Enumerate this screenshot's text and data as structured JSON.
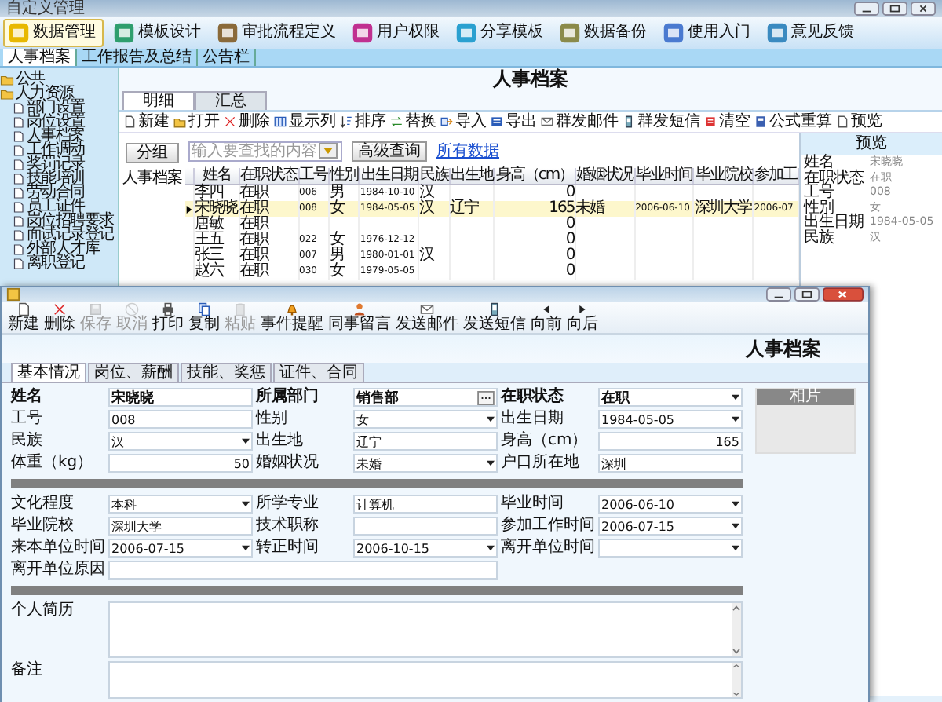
{
  "window": {
    "title": "自定义管理"
  },
  "main_toolbar": [
    {
      "label": "数据管理",
      "selected": true
    },
    {
      "label": "模板设计",
      "selected": false
    },
    {
      "label": "审批流程定义",
      "selected": false
    },
    {
      "label": "用户权限",
      "selected": false
    },
    {
      "label": "分享模板",
      "selected": false
    },
    {
      "label": "数据备份",
      "selected": false
    },
    {
      "label": "使用入门",
      "selected": false
    },
    {
      "label": "意见反馈",
      "selected": false
    }
  ],
  "doc_tabs": [
    {
      "label": "人事档案",
      "selected": true
    },
    {
      "label": "工作报告及总结",
      "selected": false
    },
    {
      "label": "公告栏",
      "selected": false
    }
  ],
  "tree": [
    {
      "label": "公共"
    },
    {
      "label": "人力资源",
      "children": [
        {
          "label": "部门设置"
        },
        {
          "label": "岗位设置"
        },
        {
          "label": "人事档案"
        },
        {
          "label": "工作调动"
        },
        {
          "label": "奖罚记录"
        },
        {
          "label": "技能培训"
        },
        {
          "label": "劳动合同"
        },
        {
          "label": "员工证件"
        },
        {
          "label": "岗位招聘要求"
        },
        {
          "label": "面试记录登记"
        },
        {
          "label": "外部人才库"
        },
        {
          "label": "离职登记"
        }
      ]
    }
  ],
  "page_title": "人事档案",
  "view_tabs": [
    {
      "label": "明细",
      "selected": true
    },
    {
      "label": "汇总",
      "selected": false
    }
  ],
  "list_toolbar": [
    "新建",
    "打开",
    "删除",
    "显示列",
    "排序",
    "替换",
    "导入",
    "导出",
    "群发邮件",
    "群发短信",
    "清空",
    "公式重算",
    "预览"
  ],
  "group_button": "分组",
  "group_tree": [
    "人事档案"
  ],
  "search": {
    "placeholder": "输入要查找的内容"
  },
  "advanced_button": "高级查询",
  "all_data_link": "所有数据",
  "table": {
    "columns": [
      "姓名",
      "在职状态",
      "工号",
      "性别",
      "出生日期",
      "民族",
      "出生地",
      "身高（cm）",
      "婚姻状况",
      "毕业时间",
      "毕业院校",
      "参加工"
    ],
    "rows": [
      {
        "selected": false,
        "cells": [
          "李四",
          "在职",
          "006",
          "男",
          "1984-10-10",
          "汉",
          "",
          "0",
          "",
          "",
          "",
          ""
        ]
      },
      {
        "selected": true,
        "cells": [
          "宋晓晓",
          "在职",
          "008",
          "女",
          "1984-05-05",
          "汉",
          "辽宁",
          "165",
          "未婚",
          "2006-06-10",
          "深圳大学",
          "2006-07"
        ]
      },
      {
        "selected": false,
        "cells": [
          "唐敏",
          "在职",
          "",
          "",
          "",
          "",
          "",
          "0",
          "",
          "",
          "",
          ""
        ]
      },
      {
        "selected": false,
        "cells": [
          "王五",
          "在职",
          "022",
          "女",
          "1976-12-12",
          "",
          "",
          "0",
          "",
          "",
          "",
          ""
        ]
      },
      {
        "selected": false,
        "cells": [
          "张三",
          "在职",
          "007",
          "男",
          "1980-01-01",
          "汉",
          "",
          "0",
          "",
          "",
          "",
          ""
        ]
      },
      {
        "selected": false,
        "cells": [
          "赵六",
          "在职",
          "030",
          "女",
          "1979-05-05",
          "",
          "",
          "0",
          "",
          "",
          "",
          ""
        ]
      }
    ]
  },
  "preview": {
    "title": "预览",
    "fields": [
      {
        "label": "姓名",
        "value": "宋晓晓"
      },
      {
        "label": "在职状态",
        "value": "在职"
      },
      {
        "label": "工号",
        "value": "008"
      },
      {
        "label": "性别",
        "value": "女"
      },
      {
        "label": "出生日期",
        "value": "1984-05-05"
      },
      {
        "label": "民族",
        "value": "汉"
      }
    ]
  },
  "dialog": {
    "toolbar": [
      {
        "label": "新建",
        "disabled": false
      },
      {
        "label": "删除",
        "disabled": false
      },
      {
        "label": "保存",
        "disabled": true
      },
      {
        "label": "取消",
        "disabled": true
      },
      {
        "label": "打印",
        "disabled": false
      },
      {
        "label": "复制",
        "disabled": false
      },
      {
        "label": "粘贴",
        "disabled": true
      },
      {
        "label": "事件提醒",
        "disabled": false
      },
      {
        "label": "同事留言",
        "disabled": false
      },
      {
        "label": "发送邮件",
        "disabled": false
      },
      {
        "label": "发送短信",
        "disabled": false
      },
      {
        "label": "向前",
        "disabled": false
      },
      {
        "label": "向后",
        "disabled": false
      }
    ],
    "title": "人事档案",
    "tabs": [
      {
        "label": "基本情况",
        "selected": true
      },
      {
        "label": "岗位、薪酬",
        "selected": false
      },
      {
        "label": "技能、奖惩",
        "selected": false
      },
      {
        "label": "证件、合同",
        "selected": false
      }
    ],
    "sections": [
      [
        {
          "label": "姓名",
          "value": "宋晓晓",
          "kind": "text",
          "bold": true
        },
        {
          "label": "所属部门",
          "value": "销售部",
          "kind": "lookup",
          "bold": true
        },
        {
          "label": "在职状态",
          "value": "在职",
          "kind": "select",
          "bold": true
        },
        {
          "label": "工号",
          "value": "008",
          "kind": "text",
          "bold": false
        },
        {
          "label": "性别",
          "value": "女",
          "kind": "select",
          "bold": false
        },
        {
          "label": "出生日期",
          "value": "1984-05-05",
          "kind": "select",
          "bold": false
        },
        {
          "label": "民族",
          "value": "汉",
          "kind": "select",
          "bold": false
        },
        {
          "label": "出生地",
          "value": "辽宁",
          "kind": "text",
          "bold": false
        },
        {
          "label": "身高（cm）",
          "value": "165",
          "kind": "number",
          "bold": false
        },
        {
          "label": "体重（kg）",
          "value": "50",
          "kind": "number",
          "bold": false
        },
        {
          "label": "婚姻状况",
          "value": "未婚",
          "kind": "select",
          "bold": false
        },
        {
          "label": "户口所在地",
          "value": "深圳",
          "kind": "text",
          "bold": false
        }
      ],
      [
        {
          "label": "文化程度",
          "value": "本科",
          "kind": "select",
          "bold": false
        },
        {
          "label": "所学专业",
          "value": "计算机",
          "kind": "text",
          "bold": false
        },
        {
          "label": "毕业时间",
          "value": "2006-06-10",
          "kind": "select",
          "bold": false
        },
        {
          "label": "毕业院校",
          "value": "深圳大学",
          "kind": "text",
          "bold": false
        },
        {
          "label": "技术职称",
          "kind": "text",
          "bold": false
        },
        {
          "label": "参加工作时间",
          "value": "2006-07-15",
          "kind": "select",
          "bold": false
        },
        {
          "label": "来本单位时间",
          "value": "2006-07-15",
          "kind": "select",
          "bold": false
        },
        {
          "label": "转正时间",
          "value": "2006-10-15",
          "kind": "select",
          "bold": false
        },
        {
          "label": "离开单位时间",
          "kind": "select",
          "bold": false
        },
        {
          "label": "离开单位原因",
          "kind": "wide",
          "bold": false
        }
      ]
    ],
    "memos": [
      {
        "label": "个人简历",
        "kind": "tall"
      },
      {
        "label": "备注",
        "kind": "short"
      }
    ],
    "photo_label": "相片"
  }
}
